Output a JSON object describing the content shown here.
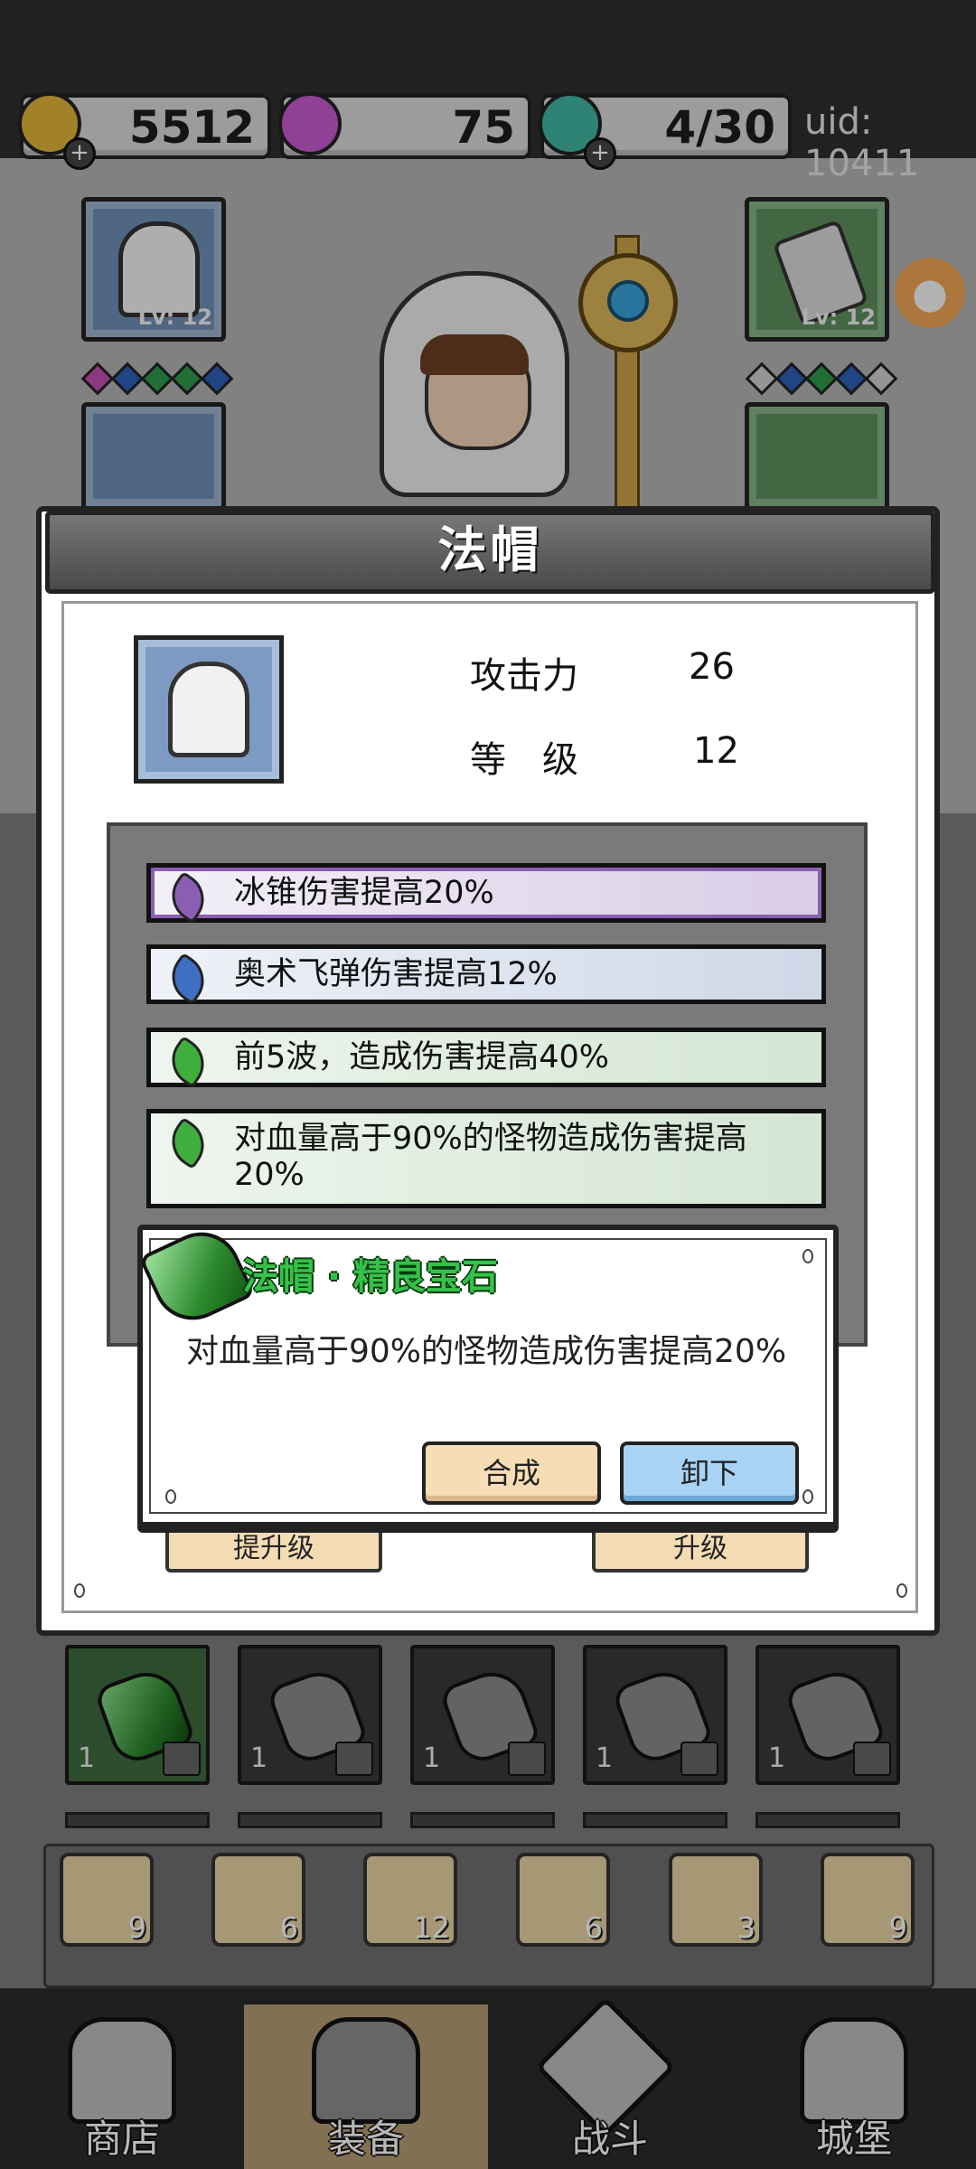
{
  "topbar": {
    "gold": "5512",
    "gems": "75",
    "energy": "4/30",
    "uid": "uid: 10411"
  },
  "equipment": {
    "left_top_level": "Lv: 12",
    "right_top_level": "Lv: 12"
  },
  "dialog": {
    "title": "法帽",
    "attack_label": "攻击力",
    "attack_value": "26",
    "level_label": "等　级",
    "level_value": "12",
    "effects": [
      {
        "text": "冰锥伤害提高20%",
        "gem_color": "#8a5fb3"
      },
      {
        "text": "奥术飞弹伤害提高12%",
        "gem_color": "#3f6fc4"
      },
      {
        "text": "前5波，造成伤害提高40%",
        "gem_color": "#3fae3f"
      },
      {
        "text": "对血量高于90%的怪物造成伤害提高20%",
        "gem_color": "#3fae3f"
      }
    ],
    "upgrade_left": "提升级",
    "upgrade_right": "升级"
  },
  "popup": {
    "title": "法帽 · 精良宝石",
    "description": "对血量高于90%的怪物造成伤害提高20%",
    "synthesize_label": "合成",
    "unequip_label": "卸下"
  },
  "inventory": {
    "items": [
      {
        "count": "1",
        "kind": "green-gem"
      },
      {
        "count": "1",
        "kind": "gray-gem"
      },
      {
        "count": "1",
        "kind": "gray-gem"
      },
      {
        "count": "1",
        "kind": "gray-gem"
      },
      {
        "count": "1",
        "kind": "gray-gem"
      }
    ],
    "scrolls": [
      {
        "count": "9"
      },
      {
        "count": "6"
      },
      {
        "count": "12"
      },
      {
        "count": "6"
      },
      {
        "count": "3"
      },
      {
        "count": "9"
      }
    ]
  },
  "nav": {
    "shop": "商店",
    "equip": "装备",
    "battle": "战斗",
    "castle": "城堡"
  },
  "colors": {
    "popup_title": "#35c24a",
    "unequip_button": "#a9d3f5",
    "synthesize_button": "#f7ddb5"
  }
}
